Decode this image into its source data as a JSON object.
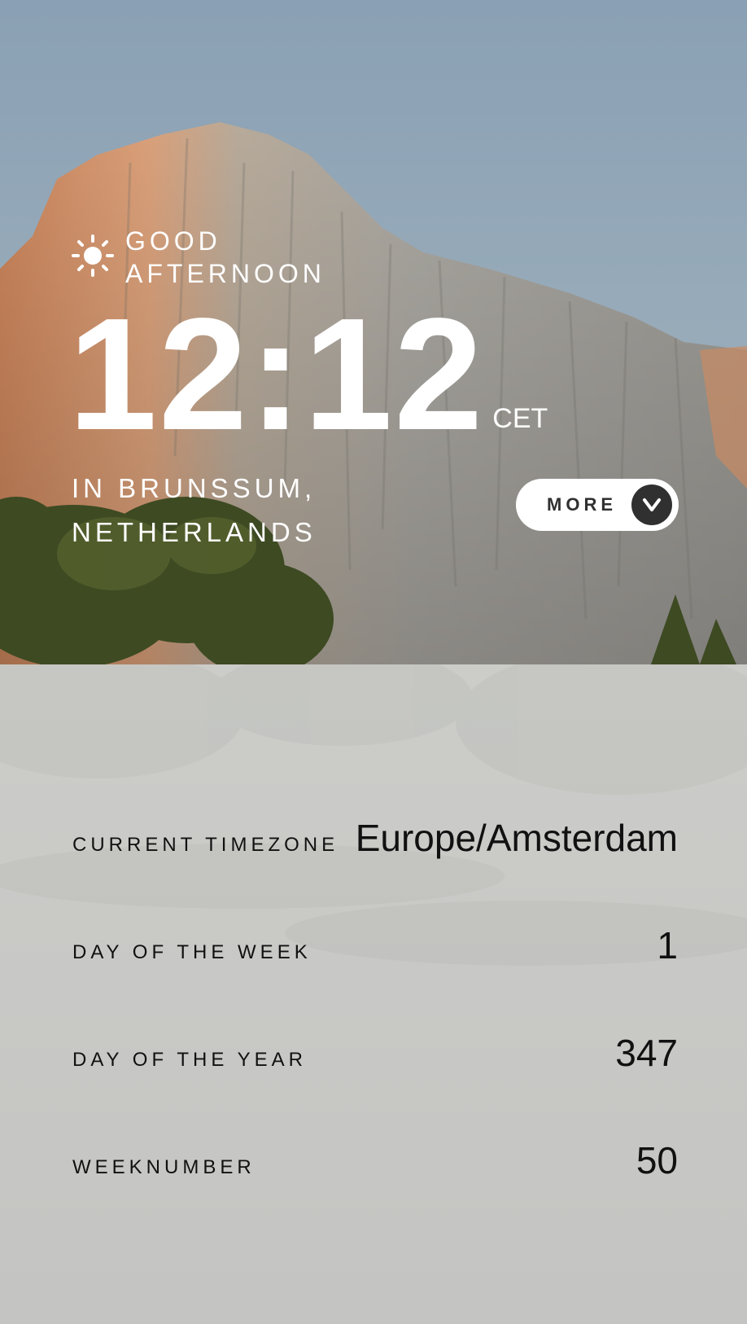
{
  "greeting": {
    "icon": "sun-icon",
    "line1": "GOOD",
    "line2": "AFTERNOON"
  },
  "clock": {
    "time": "12:12",
    "timezone_abbr": "CET"
  },
  "location": {
    "line1": "IN BRUNSSUM,",
    "line2": "NETHERLANDS"
  },
  "more_button": {
    "label": "MORE",
    "icon": "chevron-down-icon",
    "icon_glyph": "v"
  },
  "details": [
    {
      "label": "CURRENT TIMEZONE",
      "value": "Europe/Amsterdam"
    },
    {
      "label": "DAY OF THE WEEK",
      "value": "1"
    },
    {
      "label": "DAY OF THE YEAR",
      "value": "347"
    },
    {
      "label": "WEEKNUMBER",
      "value": "50"
    }
  ],
  "colors": {
    "text_on_image": "#ffffff",
    "button_bg": "#ffffff",
    "button_text": "#303030",
    "panel_text": "#111111"
  }
}
